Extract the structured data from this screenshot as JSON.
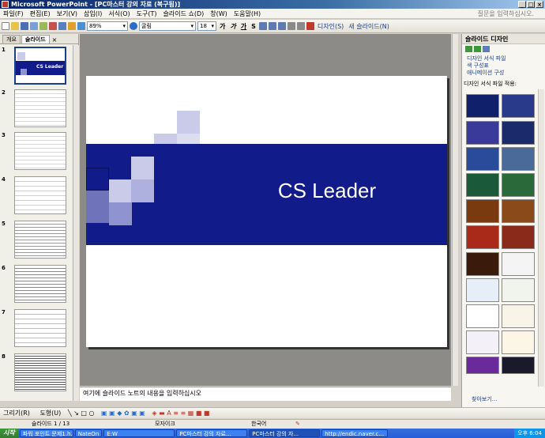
{
  "window": {
    "title": "Microsoft PowerPoint - [PC마스터 강의 자료 (복구됨)]"
  },
  "menu": [
    "파일(F)",
    "편집(E)",
    "보기(V)",
    "삽입(I)",
    "서식(O)",
    "도구(T)",
    "슬라이드 쇼(D)",
    "창(W)",
    "도움말(H)"
  ],
  "help_placeholder": "질문을 입력하십시오.",
  "toolbar": {
    "zoom": "89%",
    "font": "굴림",
    "size": "18",
    "bold": "가",
    "italic": "가",
    "underline": "가",
    "shadow": "S",
    "design_btn": "디자인(S)",
    "new_slide_btn": "새 슬라이드(N)"
  },
  "outline": {
    "tabs": [
      "개요",
      "슬라이드"
    ],
    "slide_numbers": [
      "1",
      "2",
      "3",
      "4",
      "5",
      "6",
      "7",
      "8"
    ],
    "first_slide_title": "CS Leader"
  },
  "slide": {
    "title": "CS Leader",
    "colors": {
      "band": "#121b8a",
      "squares_light": "#c9cbe9",
      "squares_mid": "#8f93cf"
    }
  },
  "notes": {
    "placeholder": "여기에 슬라이드 노트의 내용을 입력하십시오"
  },
  "taskpane": {
    "title": "슬라이드 디자인",
    "links": [
      "디자인 서식 파일",
      "색 구성표",
      "애니메이션 구성"
    ],
    "section_label": "디자인 서식 파일 적용:",
    "browse": "찾아보기..."
  },
  "drawing": {
    "draw_label": "그리기(R)",
    "autoshapes_label": "도형(U)"
  },
  "status": {
    "slide_position": "슬라이드 1 / 13",
    "design_name": "모자이크",
    "language": "한국어"
  },
  "taskbar": {
    "start": "시작",
    "tasks": [
      "파워 포인트 문제1.h...",
      "NateOn",
      "E:W",
      "PC마스터 강의 자료...",
      "PC마스터 강의 자...",
      "http://endic.naver.c..."
    ],
    "clock": "오후 6:04"
  }
}
